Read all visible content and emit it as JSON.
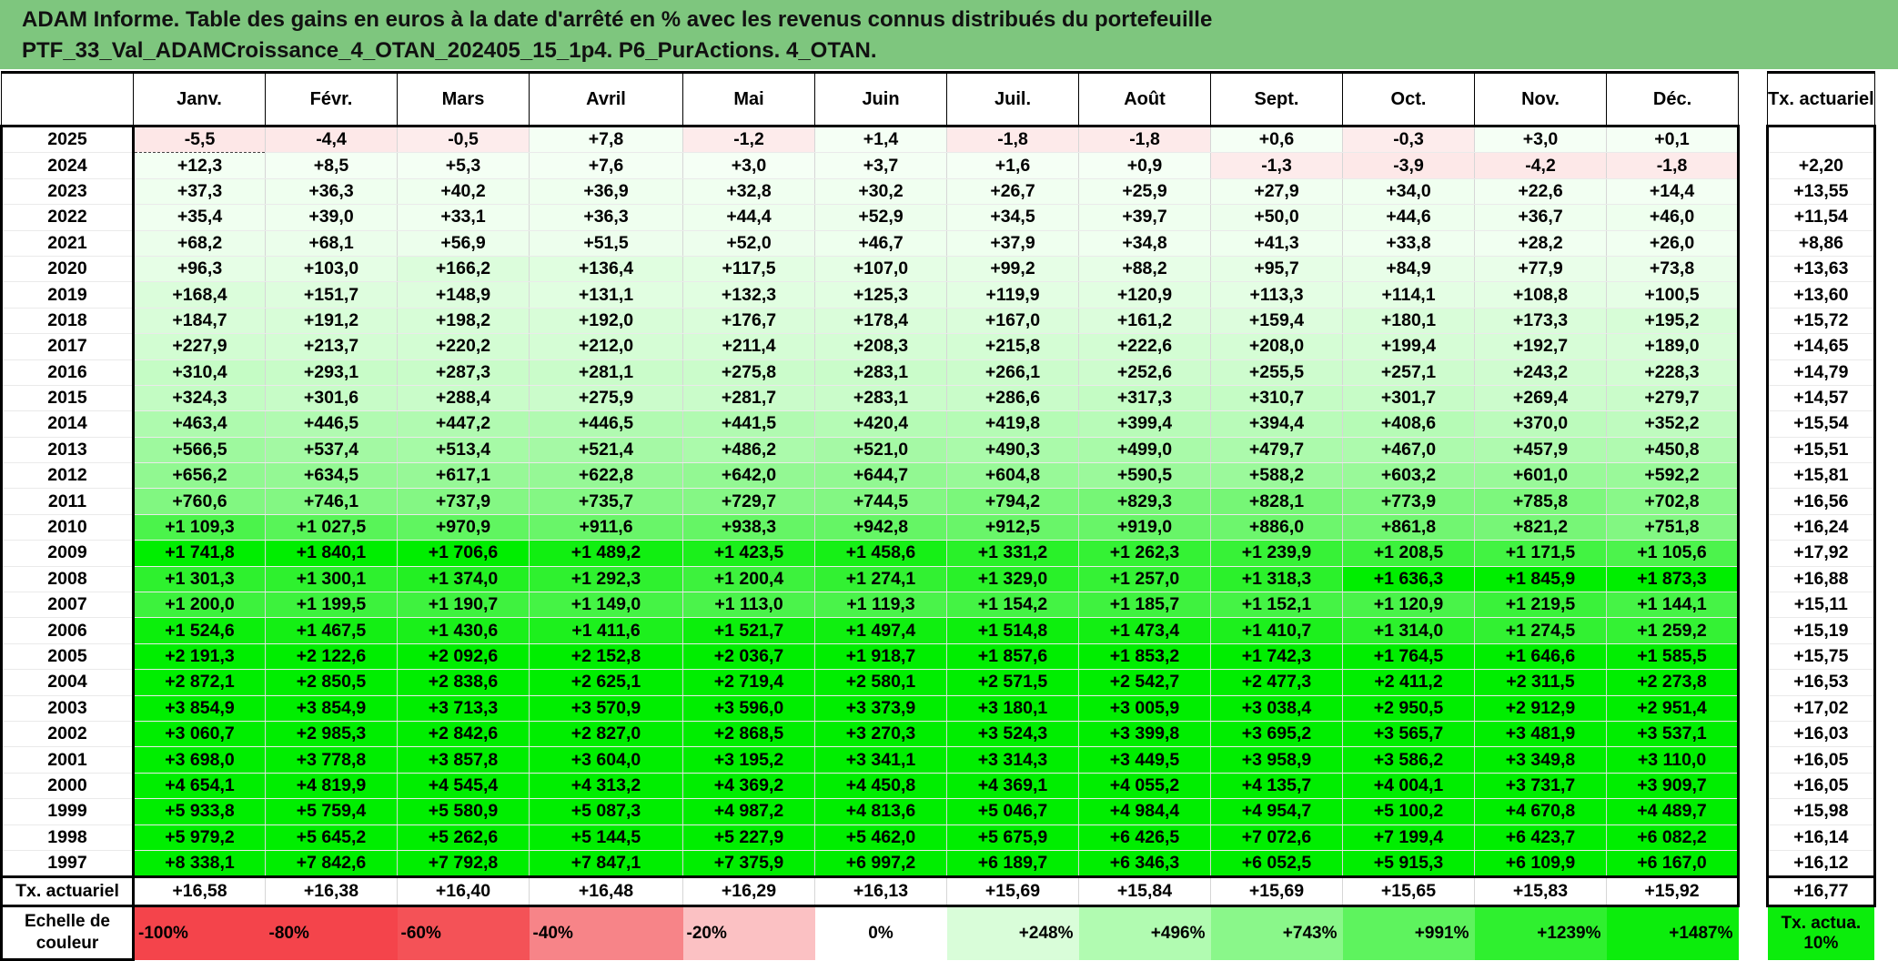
{
  "title": {
    "line1": "ADAM Informe. Table des gains en euros à la date d'arrêté en % avec les revenus connus distribués du portefeuille",
    "line2": "PTF_33_Val_ADAMCroissance_4_OTAN_202405_15_1p4. P6_PurActions. 4_OTAN."
  },
  "headers": {
    "months": [
      "Janv.",
      "Févr.",
      "Mars",
      "Avril",
      "Mai",
      "Juin",
      "Juil.",
      "Août",
      "Sept.",
      "Oct.",
      "Nov.",
      "Déc."
    ],
    "annual": "Tx. actuariel"
  },
  "rows": [
    {
      "year": "2025",
      "values": [
        "-5,5",
        "-4,4",
        "-0,5",
        "+7,8",
        "-1,2",
        "+1,4",
        "-1,8",
        "-1,8",
        "+0,6",
        "-0,3",
        "+3,0",
        "+0,1"
      ],
      "annual": ""
    },
    {
      "year": "2024",
      "values": [
        "+12,3",
        "+8,5",
        "+5,3",
        "+7,6",
        "+3,0",
        "+3,7",
        "+1,6",
        "+0,9",
        "-1,3",
        "-3,9",
        "-4,2",
        "-1,8"
      ],
      "annual": "+2,20"
    },
    {
      "year": "2023",
      "values": [
        "+37,3",
        "+36,3",
        "+40,2",
        "+36,9",
        "+32,8",
        "+30,2",
        "+26,7",
        "+25,9",
        "+27,9",
        "+34,0",
        "+22,6",
        "+14,4"
      ],
      "annual": "+13,55"
    },
    {
      "year": "2022",
      "values": [
        "+35,4",
        "+39,0",
        "+33,1",
        "+36,3",
        "+44,4",
        "+52,9",
        "+34,5",
        "+39,7",
        "+50,0",
        "+44,6",
        "+36,7",
        "+46,0"
      ],
      "annual": "+11,54"
    },
    {
      "year": "2021",
      "values": [
        "+68,2",
        "+68,1",
        "+56,9",
        "+51,5",
        "+52,0",
        "+46,7",
        "+37,9",
        "+34,8",
        "+41,3",
        "+33,8",
        "+28,2",
        "+26,0"
      ],
      "annual": "+8,86"
    },
    {
      "year": "2020",
      "values": [
        "+96,3",
        "+103,0",
        "+166,2",
        "+136,4",
        "+117,5",
        "+107,0",
        "+99,2",
        "+88,2",
        "+95,7",
        "+84,9",
        "+77,9",
        "+73,8"
      ],
      "annual": "+13,63"
    },
    {
      "year": "2019",
      "values": [
        "+168,4",
        "+151,7",
        "+148,9",
        "+131,1",
        "+132,3",
        "+125,3",
        "+119,9",
        "+120,9",
        "+113,3",
        "+114,1",
        "+108,8",
        "+100,5"
      ],
      "annual": "+13,60"
    },
    {
      "year": "2018",
      "values": [
        "+184,7",
        "+191,2",
        "+198,2",
        "+192,0",
        "+176,7",
        "+178,4",
        "+167,0",
        "+161,2",
        "+159,4",
        "+180,1",
        "+173,3",
        "+195,2"
      ],
      "annual": "+15,72"
    },
    {
      "year": "2017",
      "values": [
        "+227,9",
        "+213,7",
        "+220,2",
        "+212,0",
        "+211,4",
        "+208,3",
        "+215,8",
        "+222,6",
        "+208,0",
        "+199,4",
        "+192,7",
        "+189,0"
      ],
      "annual": "+14,65"
    },
    {
      "year": "2016",
      "values": [
        "+310,4",
        "+293,1",
        "+287,3",
        "+281,1",
        "+275,8",
        "+283,1",
        "+266,1",
        "+252,6",
        "+255,5",
        "+257,1",
        "+243,2",
        "+228,3"
      ],
      "annual": "+14,79"
    },
    {
      "year": "2015",
      "values": [
        "+324,3",
        "+301,6",
        "+288,4",
        "+275,9",
        "+281,7",
        "+283,1",
        "+286,6",
        "+317,3",
        "+310,7",
        "+301,7",
        "+269,4",
        "+279,7"
      ],
      "annual": "+14,57"
    },
    {
      "year": "2014",
      "values": [
        "+463,4",
        "+446,5",
        "+447,2",
        "+446,5",
        "+441,5",
        "+420,4",
        "+419,8",
        "+399,4",
        "+394,4",
        "+408,6",
        "+370,0",
        "+352,2"
      ],
      "annual": "+15,54"
    },
    {
      "year": "2013",
      "values": [
        "+566,5",
        "+537,4",
        "+513,4",
        "+521,4",
        "+486,2",
        "+521,0",
        "+490,3",
        "+499,0",
        "+479,7",
        "+467,0",
        "+457,9",
        "+450,8"
      ],
      "annual": "+15,51"
    },
    {
      "year": "2012",
      "values": [
        "+656,2",
        "+634,5",
        "+617,1",
        "+622,8",
        "+642,0",
        "+644,7",
        "+604,8",
        "+590,5",
        "+588,2",
        "+603,2",
        "+601,0",
        "+592,2"
      ],
      "annual": "+15,81"
    },
    {
      "year": "2011",
      "values": [
        "+760,6",
        "+746,1",
        "+737,9",
        "+735,7",
        "+729,7",
        "+744,5",
        "+794,2",
        "+829,3",
        "+828,1",
        "+773,9",
        "+785,8",
        "+702,8"
      ],
      "annual": "+16,56"
    },
    {
      "year": "2010",
      "values": [
        "+1 109,3",
        "+1 027,5",
        "+970,9",
        "+911,6",
        "+938,3",
        "+942,8",
        "+912,5",
        "+919,0",
        "+886,0",
        "+861,8",
        "+821,2",
        "+751,8"
      ],
      "annual": "+16,24"
    },
    {
      "year": "2009",
      "values": [
        "+1 741,8",
        "+1 840,1",
        "+1 706,6",
        "+1 489,2",
        "+1 423,5",
        "+1 458,6",
        "+1 331,2",
        "+1 262,3",
        "+1 239,9",
        "+1 208,5",
        "+1 171,5",
        "+1 105,6"
      ],
      "annual": "+17,92"
    },
    {
      "year": "2008",
      "values": [
        "+1 301,3",
        "+1 300,1",
        "+1 374,0",
        "+1 292,3",
        "+1 200,4",
        "+1 274,1",
        "+1 329,0",
        "+1 257,0",
        "+1 318,3",
        "+1 636,3",
        "+1 845,9",
        "+1 873,3"
      ],
      "annual": "+16,88"
    },
    {
      "year": "2007",
      "values": [
        "+1 200,0",
        "+1 199,5",
        "+1 190,7",
        "+1 149,0",
        "+1 113,0",
        "+1 119,3",
        "+1 154,2",
        "+1 185,7",
        "+1 152,1",
        "+1 120,9",
        "+1 219,5",
        "+1 144,1"
      ],
      "annual": "+15,11"
    },
    {
      "year": "2006",
      "values": [
        "+1 524,6",
        "+1 467,5",
        "+1 430,6",
        "+1 411,6",
        "+1 521,7",
        "+1 497,4",
        "+1 514,8",
        "+1 473,4",
        "+1 410,7",
        "+1 314,0",
        "+1 274,5",
        "+1 259,2"
      ],
      "annual": "+15,19"
    },
    {
      "year": "2005",
      "values": [
        "+2 191,3",
        "+2 122,6",
        "+2 092,6",
        "+2 152,8",
        "+2 036,7",
        "+1 918,7",
        "+1 857,6",
        "+1 853,2",
        "+1 742,3",
        "+1 764,5",
        "+1 646,6",
        "+1 585,5"
      ],
      "annual": "+15,75"
    },
    {
      "year": "2004",
      "values": [
        "+2 872,1",
        "+2 850,5",
        "+2 838,6",
        "+2 625,1",
        "+2 719,4",
        "+2 580,1",
        "+2 571,5",
        "+2 542,7",
        "+2 477,3",
        "+2 411,2",
        "+2 311,5",
        "+2 273,8"
      ],
      "annual": "+16,53"
    },
    {
      "year": "2003",
      "values": [
        "+3 854,9",
        "+3 854,9",
        "+3 713,3",
        "+3 570,9",
        "+3 596,0",
        "+3 373,9",
        "+3 180,1",
        "+3 005,9",
        "+3 038,4",
        "+2 950,5",
        "+2 912,9",
        "+2 951,4"
      ],
      "annual": "+17,02"
    },
    {
      "year": "2002",
      "values": [
        "+3 060,7",
        "+2 985,3",
        "+2 842,6",
        "+2 827,0",
        "+2 868,5",
        "+3 270,3",
        "+3 524,3",
        "+3 399,8",
        "+3 695,2",
        "+3 565,7",
        "+3 481,9",
        "+3 537,1"
      ],
      "annual": "+16,03"
    },
    {
      "year": "2001",
      "values": [
        "+3 698,0",
        "+3 778,8",
        "+3 857,8",
        "+3 604,0",
        "+3 195,2",
        "+3 341,1",
        "+3 314,3",
        "+3 449,5",
        "+3 958,9",
        "+3 586,2",
        "+3 349,8",
        "+3 110,0"
      ],
      "annual": "+16,05"
    },
    {
      "year": "2000",
      "values": [
        "+4 654,1",
        "+4 819,9",
        "+4 545,4",
        "+4 313,2",
        "+4 369,2",
        "+4 450,8",
        "+4 369,1",
        "+4 055,2",
        "+4 135,7",
        "+4 004,1",
        "+3 731,7",
        "+3 909,7"
      ],
      "annual": "+16,05"
    },
    {
      "year": "1999",
      "values": [
        "+5 933,8",
        "+5 759,4",
        "+5 580,9",
        "+5 087,3",
        "+4 987,2",
        "+4 813,6",
        "+5 046,7",
        "+4 984,4",
        "+4 954,7",
        "+5 100,2",
        "+4 670,8",
        "+4 489,7"
      ],
      "annual": "+15,98"
    },
    {
      "year": "1998",
      "values": [
        "+5 979,2",
        "+5 645,2",
        "+5 262,6",
        "+5 144,5",
        "+5 227,9",
        "+5 462,0",
        "+5 675,9",
        "+6 426,5",
        "+7 072,6",
        "+7 199,4",
        "+6 423,7",
        "+6 082,2"
      ],
      "annual": "+16,14"
    },
    {
      "year": "1997",
      "values": [
        "+8 338,1",
        "+7 842,6",
        "+7 792,8",
        "+7 847,1",
        "+7 375,9",
        "+6 997,2",
        "+6 189,7",
        "+6 346,3",
        "+6 052,5",
        "+5 915,3",
        "+6 109,9",
        "+6 167,0"
      ],
      "annual": "+16,12"
    }
  ],
  "tx_actuariel": {
    "label": "Tx. actuariel",
    "values": [
      "+16,58",
      "+16,38",
      "+16,40",
      "+16,48",
      "+16,29",
      "+16,13",
      "+15,69",
      "+15,84",
      "+15,69",
      "+15,65",
      "+15,83",
      "+15,92"
    ],
    "annual": "+16,77"
  },
  "scale": {
    "label": "Echelle de couleur",
    "cells": [
      {
        "text": "-100%",
        "color": "#f4444b",
        "align": "left"
      },
      {
        "text": "-80%",
        "color": "#f4444b",
        "align": "left"
      },
      {
        "text": "-60%",
        "color": "#f45257",
        "align": "left"
      },
      {
        "text": "-40%",
        "color": "#f78488",
        "align": "left"
      },
      {
        "text": "-20%",
        "color": "#fbc1c3",
        "align": "left"
      },
      {
        "text": "0%",
        "color": "#ffffff",
        "align": "center"
      },
      {
        "text": "+248%",
        "color": "#d9fdd9",
        "align": "right"
      },
      {
        "text": "+496%",
        "color": "#b1fbb1",
        "align": "right"
      },
      {
        "text": "+743%",
        "color": "#8af78a",
        "align": "right"
      },
      {
        "text": "+991%",
        "color": "#5ef35e",
        "align": "right"
      },
      {
        "text": "+1239%",
        "color": "#2ff02f",
        "align": "right"
      },
      {
        "text": "+1487%",
        "color": "#0ced0c",
        "align": "right"
      }
    ],
    "annual_label": "Tx. actua. 10%",
    "annual_color": "#0ced0c"
  },
  "colors": {
    "title_bg": "#7ec67e",
    "negative": "#fde6e6",
    "positive_max": "#00ee00"
  }
}
